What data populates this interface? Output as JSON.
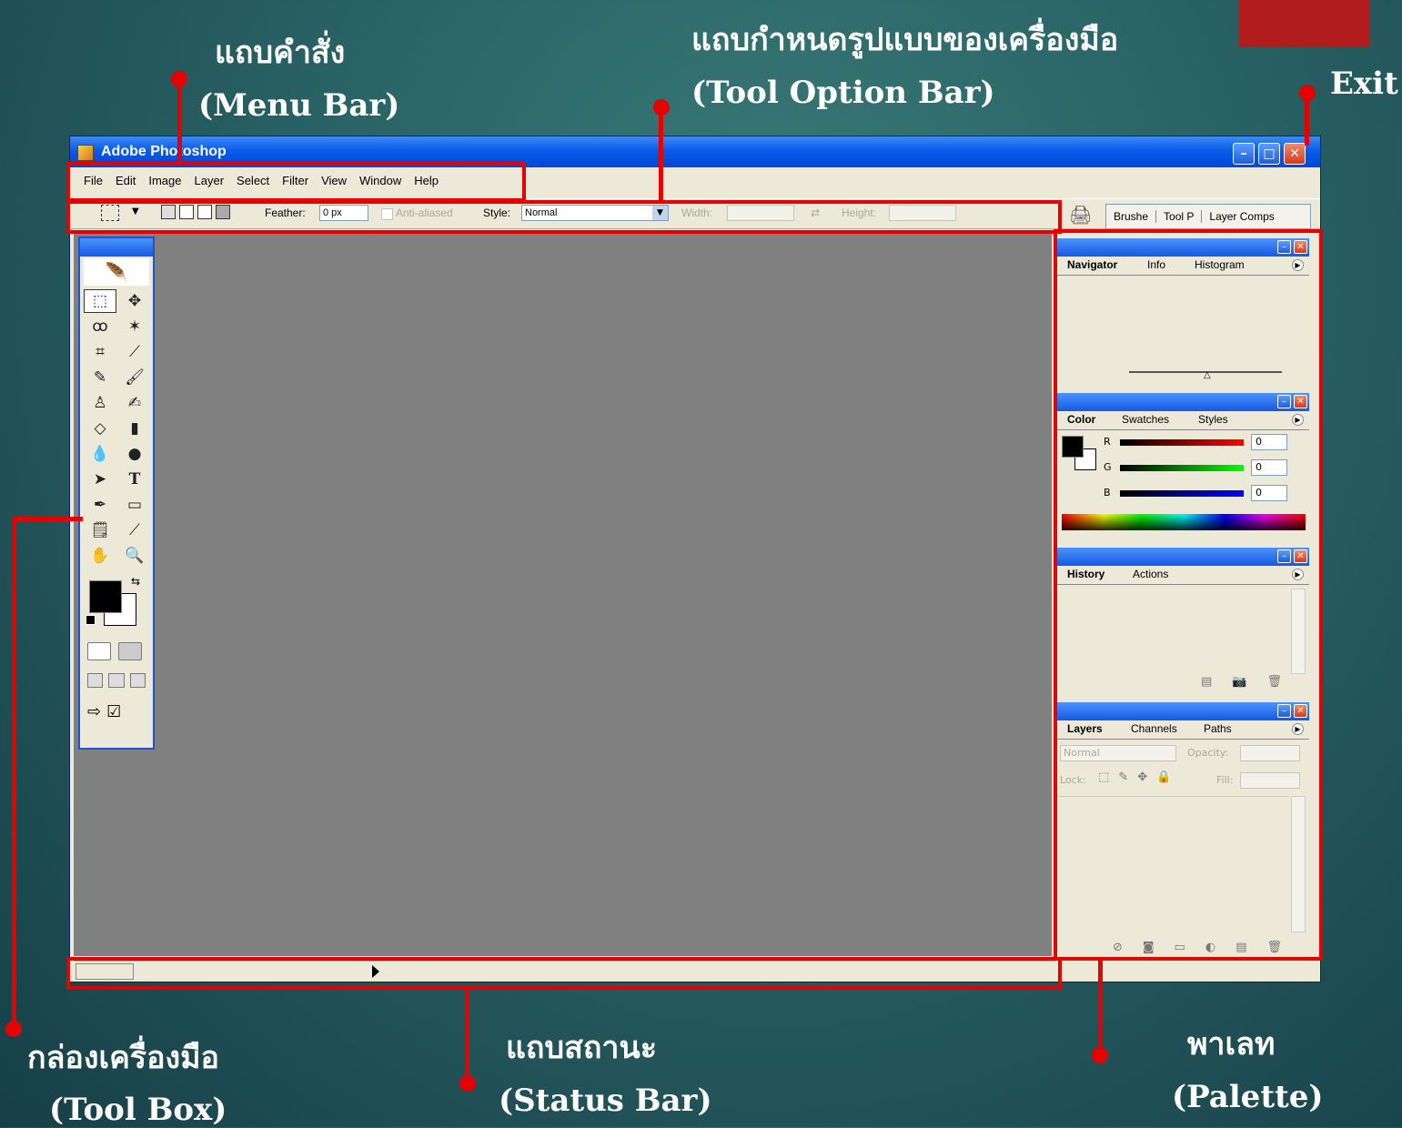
{
  "annotations": {
    "menu_bar_thai": "แถบคำสั่ง",
    "menu_bar_en": "(Menu Bar)",
    "tool_option_thai": "แถบกำหนดรูปแบบของเครื่องมือ",
    "tool_option_en": "(Tool Option  Bar)",
    "exit": "Exit",
    "toolbox_thai": "กล่องเครื่องมือ",
    "toolbox_en": "(Tool Box)",
    "status_thai": "แถบสถานะ",
    "status_en": "(Status Bar)",
    "palette_thai": "พาเลท",
    "palette_en": "(Palette)"
  },
  "colors": {
    "annotation_red": "#e60000",
    "exit_block": "#b11c1c"
  },
  "window": {
    "title": "Adobe Photoshop",
    "menu": [
      "File",
      "Edit",
      "Image",
      "Layer",
      "Select",
      "Filter",
      "View",
      "Window",
      "Help"
    ],
    "options": {
      "feather_label": "Feather:",
      "feather_value": "0 px",
      "anti_aliased": "Anti-aliased",
      "style_label": "Style:",
      "style_value": "Normal",
      "width_label": "Width:",
      "height_label": "Height:"
    },
    "well_tabs": [
      "Brushe",
      "Tool P",
      "Layer Comps"
    ]
  },
  "palettes": {
    "navigator_tabs": [
      "Navigator",
      "Info",
      "Histogram"
    ],
    "color_tabs": [
      "Color",
      "Swatches",
      "Styles"
    ],
    "rgb": [
      {
        "label": "R",
        "value": "0"
      },
      {
        "label": "G",
        "value": "0"
      },
      {
        "label": "B",
        "value": "0"
      }
    ],
    "history_tabs": [
      "History",
      "Actions"
    ],
    "layers_tabs": [
      "Layers",
      "Channels",
      "Paths"
    ],
    "layers_blend": "Normal",
    "opacity_label": "Opacity:",
    "lock_label": "Lock:",
    "fill_label": "Fill:"
  }
}
